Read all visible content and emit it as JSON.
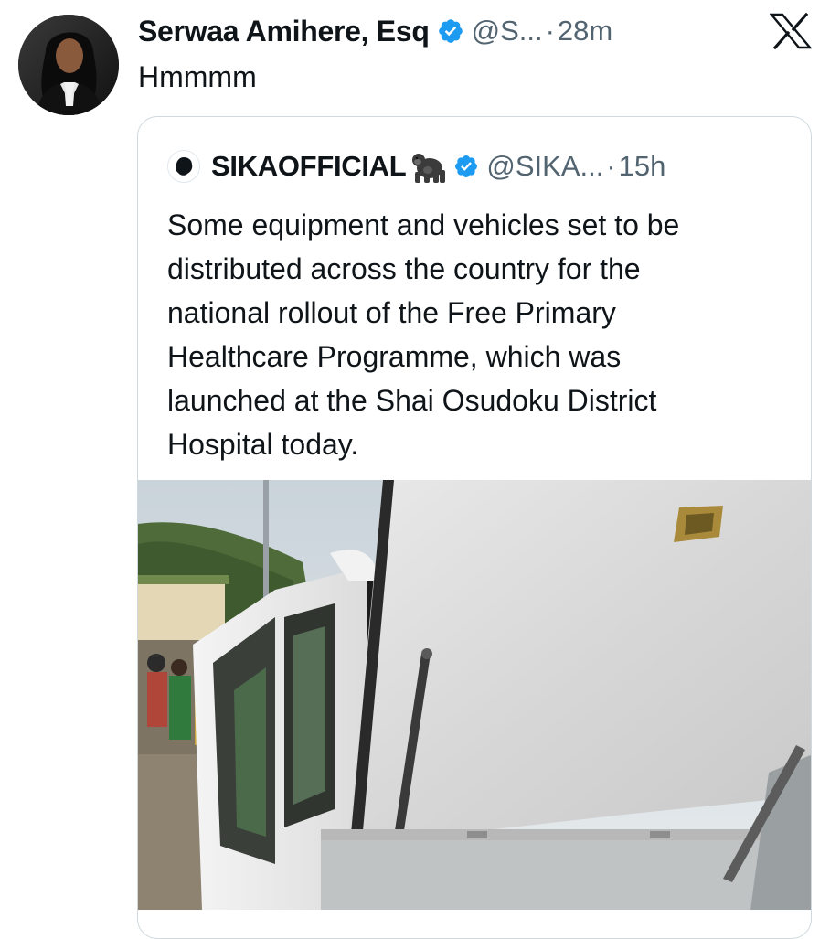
{
  "tweet": {
    "author_name": "Serwaa Amihere, Esq",
    "handle": "@S...",
    "separator": "·",
    "time": "28m",
    "text": "Hmmmm"
  },
  "quoted": {
    "author_name": "SIKAOFFICIAL",
    "handle": "@SIKA...",
    "separator": "·",
    "time": "15h",
    "text_lines": [
      "Some equipment and vehicles set to be",
      "distributed across the country for the",
      "national rollout of the Free Primary",
      "Healthcare Programme, which was",
      "launched at the Shai Osudoku District",
      "Hospital today."
    ]
  },
  "icons": {
    "verified": "verified-badge-icon",
    "x_logo": "x-logo-icon",
    "gorilla": "gorilla-emoji-icon"
  },
  "colors": {
    "verified": "#1d9bf0",
    "secondary_text": "#536471",
    "border": "#cfd9de"
  }
}
